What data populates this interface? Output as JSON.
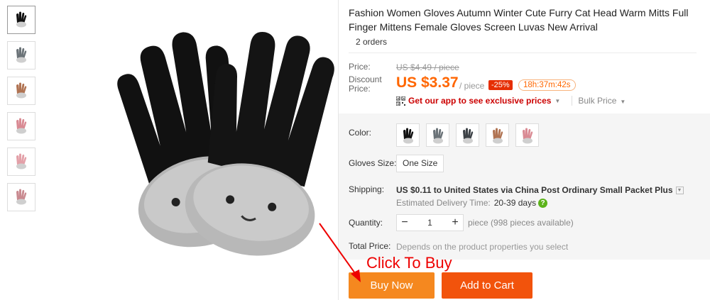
{
  "product": {
    "title": "Fashion Women Gloves Autumn Winter Cute Furry Cat Head Warm Mitts Full Finger Mittens Female Gloves Screen Luvas New Arrival",
    "orders": "2 orders"
  },
  "pricing": {
    "price_label": "Price:",
    "old_price": "US $4.49 / piece",
    "discount_label": "Discount Price:",
    "discount_price": "US $3.37",
    "per_piece": "/ piece",
    "discount_pct": "-25%",
    "countdown": "18h:37m:42s",
    "app_promo": "Get our app to see exclusive prices",
    "bulk_price": "Bulk Price"
  },
  "options": {
    "color_label": "Color:",
    "colors": [
      "#111111",
      "#6b7378",
      "#3d4247",
      "#b07352",
      "#d98a93"
    ],
    "size_label": "Gloves Size:",
    "size_value": "One Size"
  },
  "shipping": {
    "label": "Shipping:",
    "cost": "US $0.11",
    "to_word": "to",
    "destination": "United States via China Post Ordinary Small Packet Plus",
    "est_label": "Estimated Delivery Time:",
    "est_days": "20-39 days",
    "help": "?"
  },
  "quantity": {
    "label": "Quantity:",
    "value": "1",
    "minus": "−",
    "plus": "+",
    "available": "piece (998 pieces available)"
  },
  "total": {
    "label": "Total Price:",
    "note": "Depends on the product properties you select"
  },
  "actions": {
    "buy_now": "Buy Now",
    "add_to_cart": "Add to Cart"
  },
  "annotation": {
    "text": "Click To Buy"
  },
  "thumbnails": [
    "#111111",
    "#6b7378",
    "#b07352",
    "#d98a93",
    "#e3a0a8",
    "#c98a90"
  ],
  "icons": {
    "qr": "qr-code-icon",
    "caret": "chevron-down-icon",
    "help": "question-icon"
  }
}
